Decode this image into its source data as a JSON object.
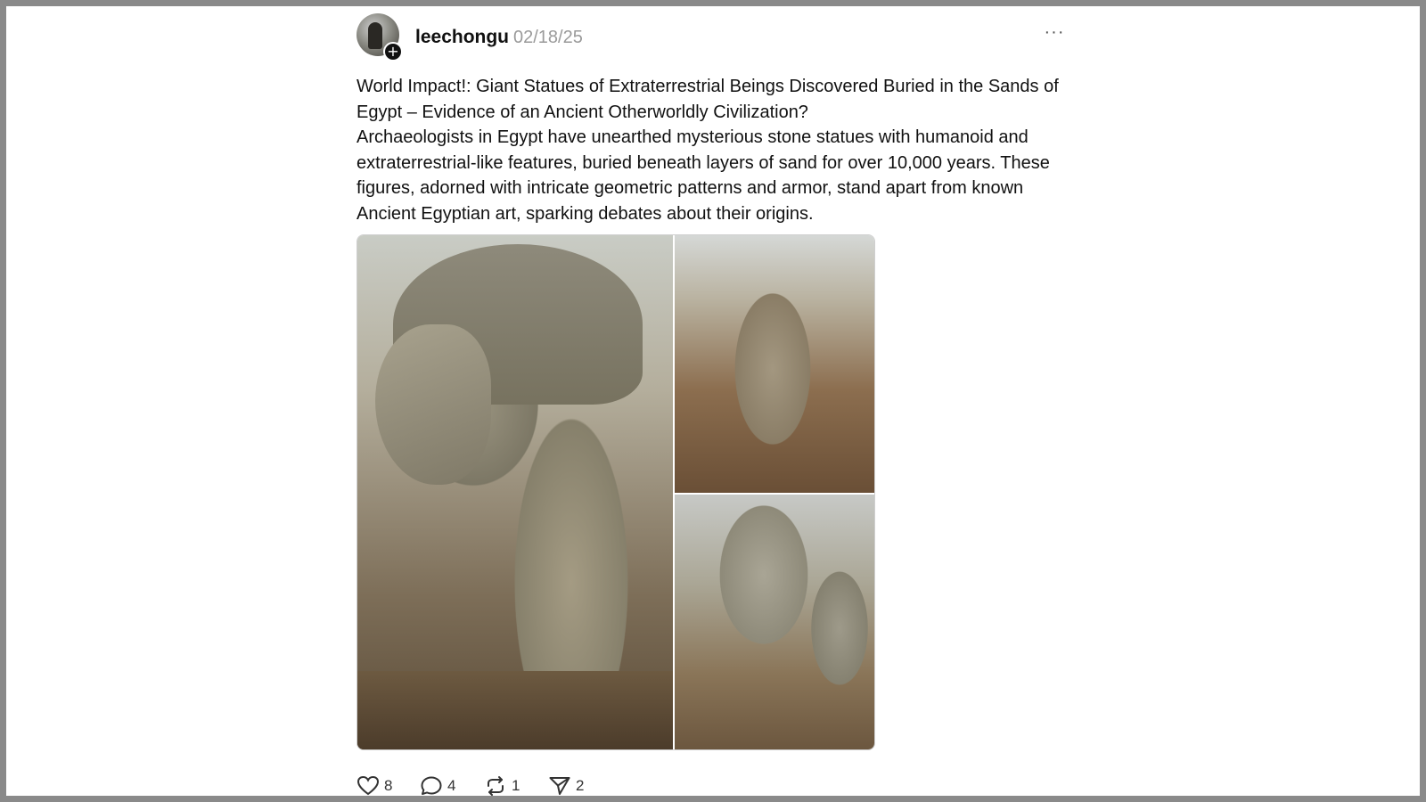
{
  "post": {
    "username": "leechongu",
    "date": "02/18/25",
    "more_label": "···",
    "follow_badge": "+",
    "text": [
      "World Impact!: Giant Statues of Extraterrestrial Beings Discovered Buried in the Sands of Egypt – Evidence of an Ancient Otherworldly Civilization?",
      "Archaeologists in Egypt have unearthed mysterious stone statues with humanoid and extraterrestrial-like features, buried beneath layers of sand for over 10,000 years. These figures, adorned with intricate geometric patterns and armor, stand apart from known Ancient Egyptian art, sparking debates about their origins."
    ],
    "images": [
      {
        "icon": "statue-closeup-image"
      },
      {
        "icon": "statue-in-pit-image"
      },
      {
        "icon": "statues-group-image"
      }
    ]
  },
  "actions": {
    "like_count": "8",
    "reply_count": "4",
    "repost_count": "1",
    "share_count": "2"
  },
  "colors": {
    "text": "#111111",
    "muted": "#9a9a9a",
    "background": "#ffffff",
    "frame": "#8a8a8a"
  }
}
